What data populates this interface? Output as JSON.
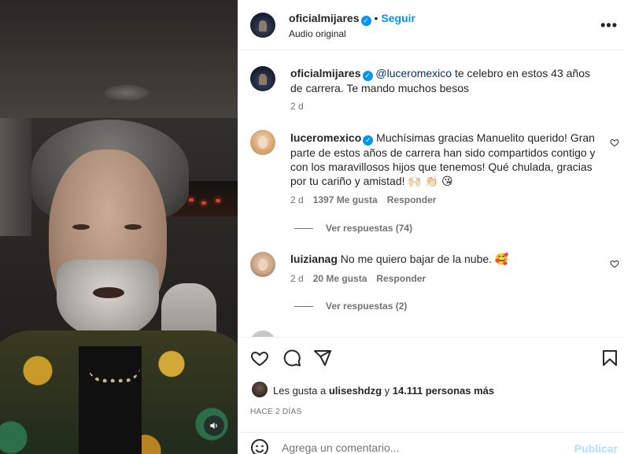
{
  "post": {
    "author": "oficialmijares",
    "follow_label": "Seguir",
    "audio": "Audio original",
    "more_icon": "more-icon"
  },
  "caption": {
    "username": "oficialmijares",
    "mention": "@luceromexico",
    "text": " te celebro en estos 43 años de carrera. Te mando muchos besos",
    "time": "2 d"
  },
  "comments": [
    {
      "username": "luceromexico",
      "verified": true,
      "text": "Muchísimas gracias Manuelito querido! Gran parte de estos años de carrera han sido compartidos contigo y con los maravillosos hijos que tenemos! Qué chulada, gracias por tu cariño y amistad! 🙌🏻 👏🏻 😘",
      "time": "2 d",
      "likes": "1397 Me gusta",
      "reply_label": "Responder",
      "view_replies": "Ver respuestas (74)"
    },
    {
      "username": "luizianag",
      "verified": false,
      "text": "No me quiero bajar de la nube. 🥰",
      "time": "2 d",
      "likes": "20 Me gusta",
      "reply_label": "Responder",
      "view_replies": "Ver respuestas (2)"
    }
  ],
  "likes": {
    "prefix": "Les gusta a ",
    "first_user": "uliseshdzg",
    "middle": " y ",
    "count": "14.111 personas más"
  },
  "time_ago": "HACE 2 DÍAS",
  "composer": {
    "placeholder": "Agrega un comentario...",
    "publish_label": "Publicar"
  },
  "colors": {
    "accent": "#0095f6",
    "publish_disabled": "#b2dffc",
    "mention": "#00376b",
    "secondary_text": "#737373"
  }
}
